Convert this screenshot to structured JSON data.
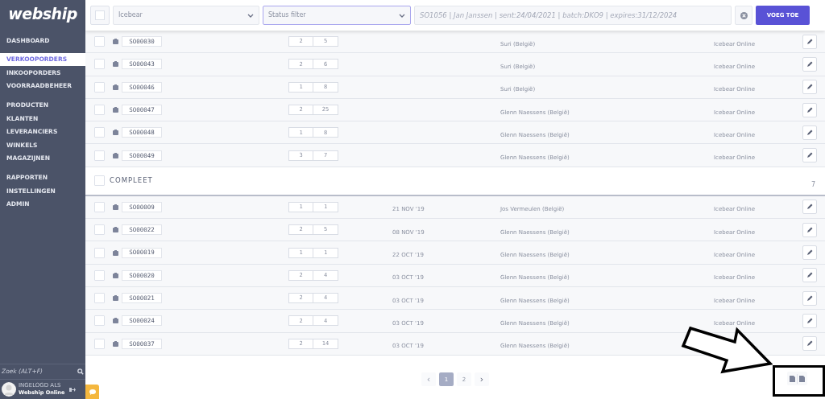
{
  "sidebar": {
    "logo": "webship",
    "groups": [
      [
        {
          "label": "DASHBOARD",
          "selected": false
        }
      ],
      [
        {
          "label": "VERKOOPORDERS",
          "selected": true
        },
        {
          "label": "INKOOPORDERS",
          "selected": false
        },
        {
          "label": "VOORRAADBEHEER",
          "selected": false
        }
      ],
      [
        {
          "label": "PRODUCTEN",
          "selected": false
        },
        {
          "label": "KLANTEN",
          "selected": false
        },
        {
          "label": "LEVERANCIERS",
          "selected": false
        },
        {
          "label": "WINKELS",
          "selected": false
        },
        {
          "label": "MAGAZIJNEN",
          "selected": false
        }
      ],
      [
        {
          "label": "RAPPORTEN",
          "selected": false
        },
        {
          "label": "INSTELLINGEN",
          "selected": false
        },
        {
          "label": "ADMIN",
          "selected": false
        }
      ]
    ],
    "search": {
      "placeholder": "Zoek (ALT+F)"
    },
    "user": {
      "label": "INGELOGD ALS",
      "name": "Webship Online"
    }
  },
  "filter_bar": {
    "select_all": {
      "checked": false
    },
    "shop_select": "Icebear",
    "status_select": "Status filter",
    "search": {
      "placeholder": "SO1056 | Jan Janssen | sent:24/04/2021 | batch:DKO9 | expires:31/12/2024"
    },
    "add_button": "VOEG TOE"
  },
  "sections": [
    {
      "rows": [
        {
          "checked": false,
          "code": "SO00030",
          "qty_1": "2",
          "qty_2": "5",
          "customer": "Suri (België)",
          "shop": "Icebear Online"
        },
        {
          "checked": false,
          "code": "SO00043",
          "qty_1": "2",
          "qty_2": "6",
          "customer": "Suri (België)",
          "shop": "Icebear Online"
        },
        {
          "checked": false,
          "code": "SO00046",
          "qty_1": "1",
          "qty_2": "8",
          "customer": "Suri (België)",
          "shop": "Icebear Online"
        },
        {
          "checked": false,
          "code": "SO00047",
          "qty_1": "2",
          "qty_2": "25",
          "customer": "Glenn Naessens (België)",
          "shop": "Icebear Online"
        },
        {
          "checked": false,
          "code": "SO00048",
          "qty_1": "1",
          "qty_2": "8",
          "customer": "Glenn Naessens (België)",
          "shop": "Icebear Online"
        },
        {
          "checked": false,
          "code": "SO00049",
          "qty_1": "3",
          "qty_2": "7",
          "customer": "Glenn Naessens (België)",
          "shop": "Icebear Online"
        }
      ]
    },
    {
      "label": "COMPLEET",
      "checked": false,
      "count": "7",
      "rows": [
        {
          "checked": false,
          "code": "SO00009",
          "qty_1": "1",
          "qty_2": "1",
          "date": "21 NOV '19",
          "customer": "Jos Vermeulen (België)",
          "shop": "Icebear Online"
        },
        {
          "checked": false,
          "code": "SO00022",
          "qty_1": "2",
          "qty_2": "5",
          "date": "08 NOV '19",
          "customer": "Glenn Naessens (België)",
          "shop": "Icebear Online"
        },
        {
          "checked": false,
          "code": "SO00019",
          "qty_1": "1",
          "qty_2": "1",
          "date": "22 OCT '19",
          "customer": "Glenn Naessens (België)",
          "shop": "Icebear Online"
        },
        {
          "checked": false,
          "code": "SO00020",
          "qty_1": "2",
          "qty_2": "4",
          "date": "03 OCT '19",
          "customer": "Glenn Naessens (België)",
          "shop": "Icebear Online"
        },
        {
          "checked": false,
          "code": "SO00021",
          "qty_1": "2",
          "qty_2": "4",
          "date": "03 OCT '19",
          "customer": "Glenn Naessens (België)",
          "shop": "Icebear Online"
        },
        {
          "checked": false,
          "code": "SO00024",
          "qty_1": "2",
          "qty_2": "4",
          "date": "03 OCT '19",
          "customer": "Glenn Naessens (België)",
          "shop": "Icebear Online"
        },
        {
          "checked": false,
          "code": "SO00037",
          "qty_1": "2",
          "qty_2": "14",
          "date": "03 OCT '19",
          "customer": "Glenn Naessens (België)"
        }
      ]
    }
  ],
  "pagination": {
    "prev": "‹",
    "pages": [
      {
        "label": "1",
        "selected": true
      },
      {
        "label": "2",
        "selected": false
      }
    ],
    "next": "›"
  }
}
